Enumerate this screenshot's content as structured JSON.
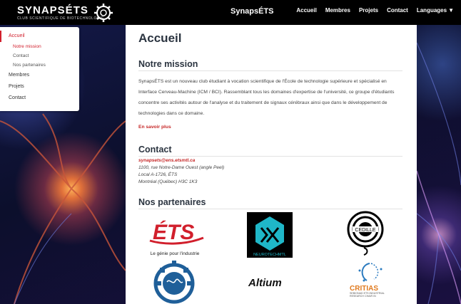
{
  "navbar": {
    "brand_name": "SYNAPSÉTS",
    "brand_tagline": "CLUB SCIENTIFIQUE DE BIOTECHNOLOGIE",
    "title": "SynapsÉTS",
    "links": [
      "Accueil",
      "Membres",
      "Projets",
      "Contact",
      "Languages"
    ]
  },
  "sidebar": {
    "accueil": "Accueil",
    "notre_mission": "Notre mission",
    "contact_sub": "Contact",
    "nos_partenaires": "Nos partenaires",
    "membres": "Membres",
    "projets": "Projets",
    "contact": "Contact"
  },
  "main": {
    "page_title": "Accueil",
    "mission": {
      "title": "Notre mission",
      "text": "SynapsÉTS est un nouveau club étudiant à vocation scientifique de l'École de technologie supérieure et spécialisé en Interface Cerveau-Machine (ICM / BCI). Rassemblant tous les domaines d'expertise de l'université, ce groupe d'étudiants concentre ses activités autour de l'analyse et du traitement de signaux cérébraux ainsi que dans le développement de technologies dans ce domaine.",
      "more": "En savoir plus"
    },
    "contact": {
      "title": "Contact",
      "email": "synapsets@ens.etsmtl.ca",
      "address1": "1100, rue Notre-Dame Ouest (angle Peel)",
      "address2": "Local A-1726, ÉTS",
      "address3": "Montréal (Québec) H3C 1K3"
    },
    "partners": {
      "title": "Nos partenaires",
      "ets_logo": "ÉTS",
      "ets_tagline": "Le génie pour l'industrie",
      "neurotech_text": "NEUROTECHMTL",
      "cedille_text": "CEDILLE",
      "altium_text": "Altium",
      "critias_text": "CRITIAS",
      "critias_sub": "SEBIONAD ETS INDUSTRIAL RESEARCH CHAIR IN"
    }
  }
}
